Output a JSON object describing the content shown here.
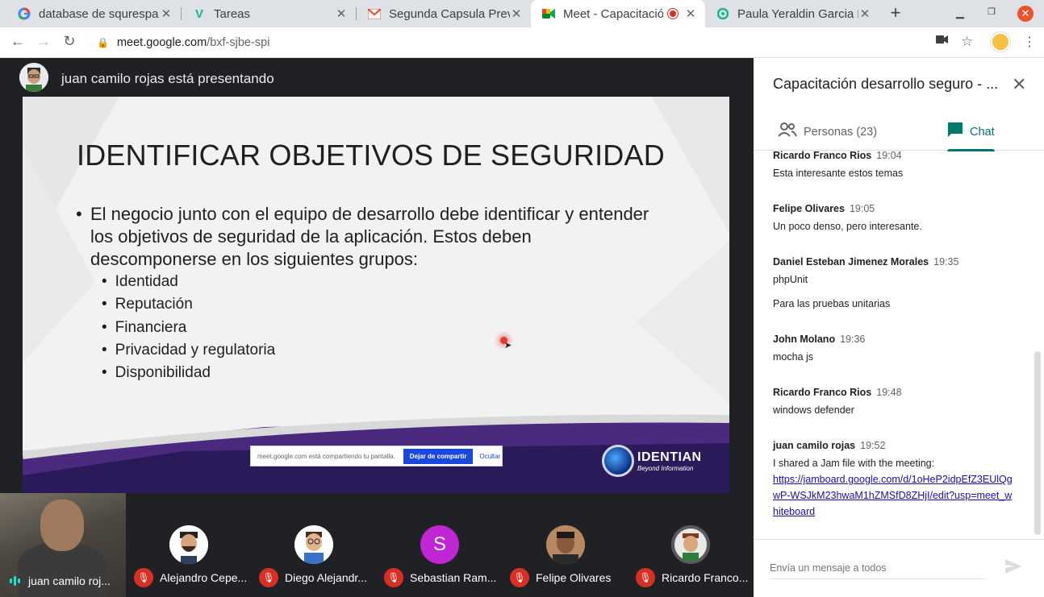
{
  "browser": {
    "tabs": [
      {
        "icon": "google-icon",
        "title": "database de squrespa"
      },
      {
        "icon": "tareas-v-icon",
        "title": "Tareas"
      },
      {
        "icon": "gmail-icon",
        "title": "Segunda Capsula Prev"
      },
      {
        "icon": "meet-icon",
        "title": "Meet - Capacitación",
        "active": true,
        "recording": true
      },
      {
        "icon": "app-icon",
        "title": "Paula Yeraldin Garcia H"
      }
    ],
    "close_glyph": "✕",
    "new_tab_glyph": "+",
    "url_host": "meet.google.com",
    "url_path": "/bxf-sjbe-spi"
  },
  "stage": {
    "presenter_text": "juan camilo rojas está presentando",
    "slide": {
      "title": "IDENTIFICAR OBJETIVOS DE SEGURIDAD",
      "bullet": "•",
      "lead": "El negocio junto con el equipo de desarrollo debe identificar y entender los objetivos de seguridad de la aplicación. Estos deben descomponerse en los siguientes grupos:",
      "items": [
        "Identidad",
        "Reputación",
        "Financiera",
        "Privacidad y regulatoria",
        "Disponibilidad"
      ],
      "share_bar": {
        "text": "meet.google.com está compartiendo tu pantalla.",
        "stop": "Dejar de compartir",
        "hide": "Ocultar"
      },
      "logo_brand": "IDENTIAN",
      "logo_tagline": "Beyond Information"
    }
  },
  "participants": {
    "self_name": "juan camilo roj...",
    "others": [
      {
        "name": "Alejandro Cepe...",
        "avatar": "bitmoji-avatar",
        "bg": "#ffffff"
      },
      {
        "name": "Diego Alejandr...",
        "avatar": "bitmoji-avatar",
        "bg": "#ffffff"
      },
      {
        "name": "Sebastian Ram...",
        "avatar": "letter-avatar",
        "letter": "S",
        "bg": "#c026d3"
      },
      {
        "name": "Felipe Olivares",
        "avatar": "photo-avatar",
        "bg": "#8a5a3c"
      },
      {
        "name": "Ricardo Franco...",
        "avatar": "bitmoji-avatar",
        "bg": "#5a5a5a"
      }
    ]
  },
  "panel": {
    "title": "Capacitación desarrollo seguro - ...",
    "tabs": {
      "people": "Personas (23)",
      "chat": "Chat"
    },
    "messages": [
      {
        "name": "Ricardo Franco Rios",
        "time": "19:04",
        "lines": [
          "Esta interesante estos temas"
        ]
      },
      {
        "name": "Felipe Olivares",
        "time": "19:05",
        "lines": [
          "Un poco denso, pero interesante."
        ]
      },
      {
        "name": "Daniel Esteban Jimenez Morales",
        "time": "19:35",
        "lines": [
          "phpUnit",
          "Para las pruebas unitarias"
        ]
      },
      {
        "name": "John Molano",
        "time": "19:36",
        "lines": [
          "mocha js"
        ]
      },
      {
        "name": "Ricardo Franco Rios",
        "time": "19:48",
        "lines": [
          "windows defender"
        ]
      },
      {
        "name": "juan camilo rojas",
        "time": "19:52",
        "lines": [
          "I shared a Jam file with the meeting:"
        ],
        "link": "https://jamboard.google.com/d/1oHeP2idpEfZ3EUlQgwP-WSJkM23hwaM1hZMSfD8ZHjI/edit?usp=meet_whiteboard"
      }
    ],
    "composer_placeholder": "Envía un mensaje a todos"
  },
  "colors": {
    "accent": "#00796b",
    "mic_off": "#d93025",
    "record": "#d93025",
    "link": "#1a0dab"
  }
}
